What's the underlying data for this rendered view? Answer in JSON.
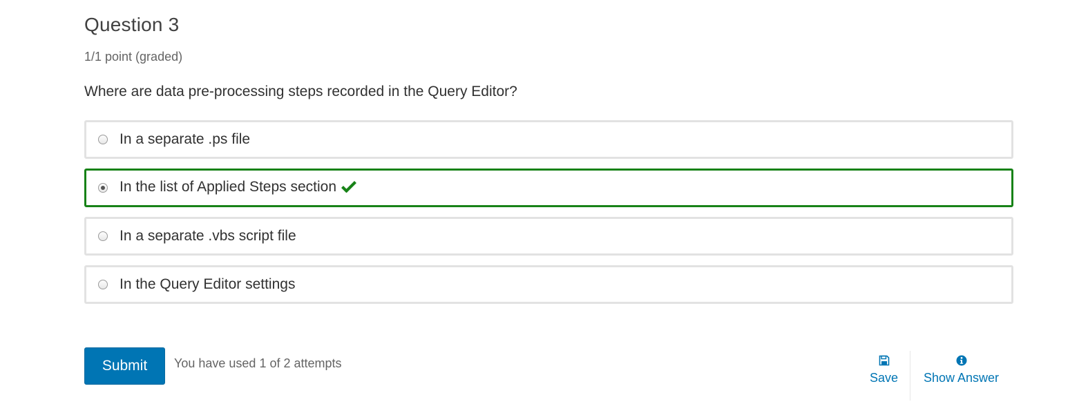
{
  "question": {
    "title": "Question 3",
    "points": "1/1 point (graded)",
    "prompt": "Where are data pre-processing steps recorded in the Query Editor?"
  },
  "choices": [
    {
      "label": "In a separate .ps file",
      "selected": false,
      "correct": false
    },
    {
      "label": "In the list of Applied Steps section",
      "selected": true,
      "correct": true
    },
    {
      "label": "In a separate .vbs script file",
      "selected": false,
      "correct": false
    },
    {
      "label": "In the Query Editor settings",
      "selected": false,
      "correct": false
    }
  ],
  "footer": {
    "submit_label": "Submit",
    "attempts_text": "You have used 1 of 2 attempts",
    "save_label": "Save",
    "show_answer_label": "Show Answer"
  },
  "icons": {
    "correct": "checkmark-icon",
    "save": "floppy-disk-icon",
    "show_answer": "info-circle-icon"
  },
  "colors": {
    "correct_border": "#178217",
    "correct_check": "#178217",
    "primary": "#0075b4",
    "choice_border": "#e2e2e2"
  }
}
